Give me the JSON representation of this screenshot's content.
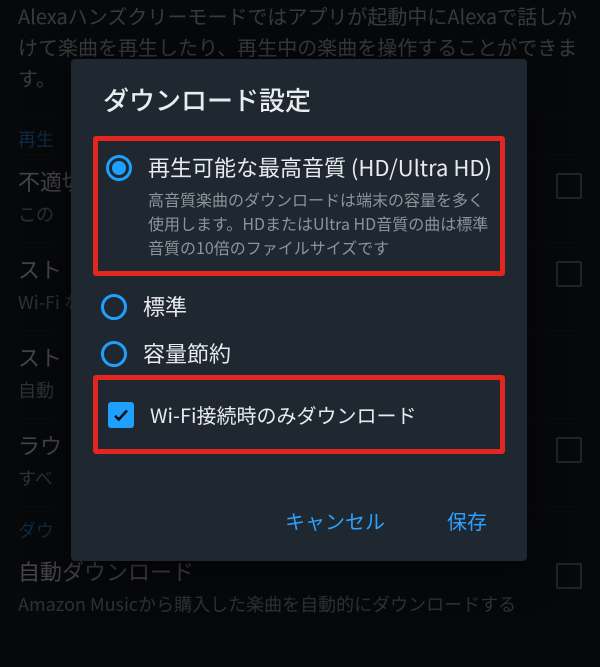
{
  "background": {
    "intro": "Alexaハンズクリーモードではアプリが起動中にAlexaで話しかけて楽曲を再生したり、再生中の楽曲を操作することができます。",
    "section_play": "再生",
    "items": [
      {
        "title": "不適切",
        "desc": "この"
      },
      {
        "title": "スト",
        "desc": "Wi-Fi\nなっ"
      },
      {
        "title": "スト",
        "desc": "自動"
      },
      {
        "title": "ラウ",
        "desc": "すべ"
      }
    ],
    "section_download": "ダウ",
    "auto_title": "自動ダウンロード",
    "auto_desc": "Amazon Musicから購入した楽曲を自動的にダウンロードする"
  },
  "dialog": {
    "title": "ダウンロード設定",
    "options": [
      {
        "id": "best",
        "label": "再生可能な最高音質 (HD/Ultra HD)",
        "sub": "高音質楽曲のダウンロードは端末の容量を多く使用します。HDまたはUltra HD音質の曲は標準音質の10倍のファイルサイズです",
        "checked": true,
        "highlighted": true
      },
      {
        "id": "standard",
        "label": "標準",
        "sub": "",
        "checked": false,
        "highlighted": false
      },
      {
        "id": "saver",
        "label": "容量節約",
        "sub": "",
        "checked": false,
        "highlighted": false
      }
    ],
    "wifi_only": {
      "label": "Wi-Fi接続時のみダウンロード",
      "checked": true,
      "highlighted": true
    },
    "cancel": "キャンセル",
    "save": "保存"
  }
}
